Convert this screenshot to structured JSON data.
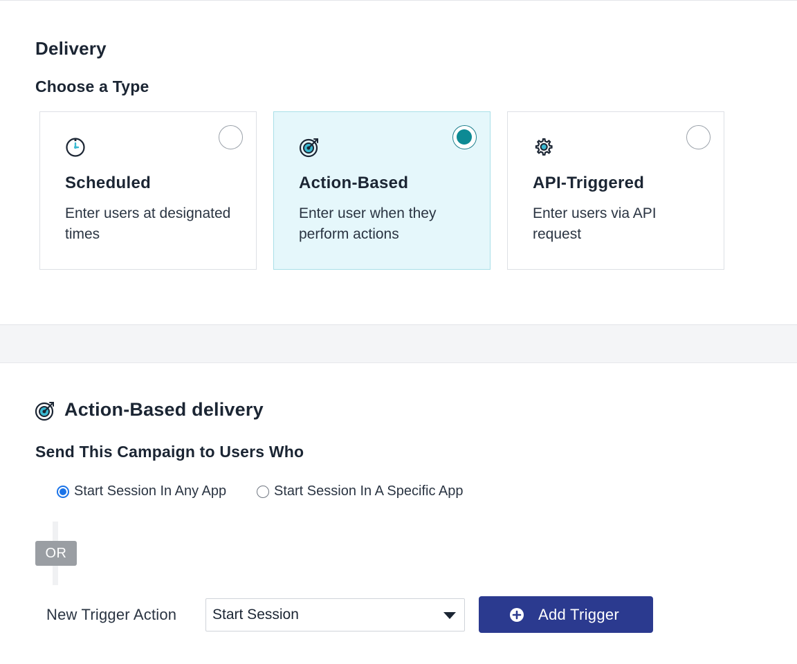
{
  "header": {
    "title": "Delivery",
    "subtitle": "Choose a Type"
  },
  "types": [
    {
      "title": "Scheduled",
      "description": "Enter users at designated times",
      "icon": "clock-icon",
      "selected": false
    },
    {
      "title": "Action-Based",
      "description": "Enter user when they perform actions",
      "icon": "target-icon",
      "selected": true
    },
    {
      "title": "API-Triggered",
      "description": "Enter users via API request",
      "icon": "gear-icon",
      "selected": false
    }
  ],
  "action_based": {
    "title": "Action-Based delivery",
    "subtitle": "Send This Campaign to Users Who",
    "options": [
      {
        "label": "Start Session In Any App",
        "checked": true
      },
      {
        "label": "Start Session In A Specific App",
        "checked": false
      }
    ],
    "or_label": "OR",
    "trigger_label": "New Trigger Action",
    "trigger_value": "Start Session",
    "add_button": "Add Trigger"
  },
  "colors": {
    "selected_card_bg": "#e5f7fb",
    "accent_teal": "#0d8a94",
    "button_blue": "#2b3a8f",
    "radio_blue": "#1a73e8"
  }
}
